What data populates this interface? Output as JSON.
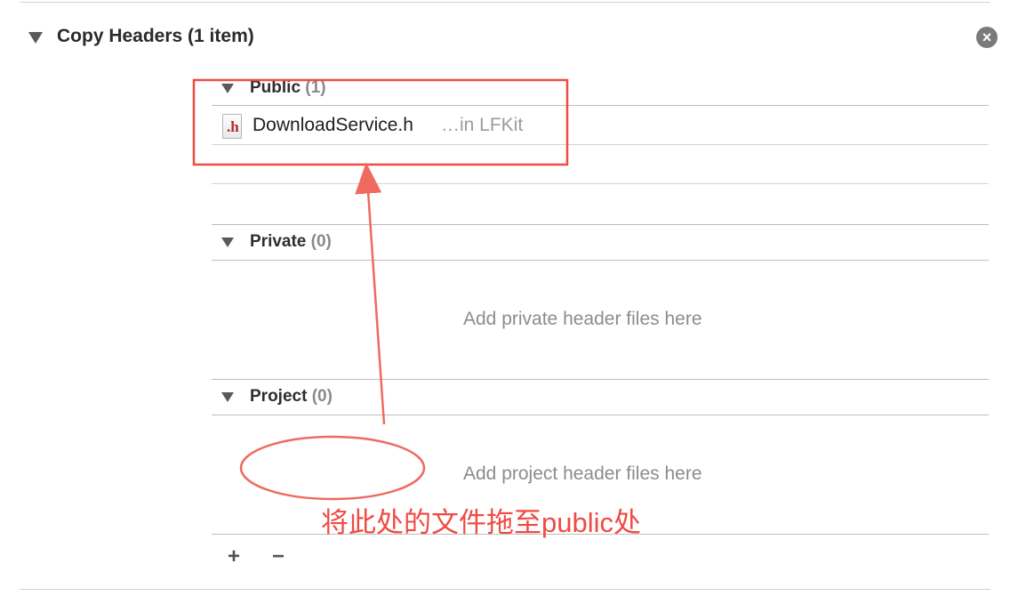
{
  "phase": {
    "title": "Copy Headers (1 item)",
    "close_symbol": "×"
  },
  "groups": {
    "public": {
      "label": "Public",
      "count": "(1)"
    },
    "private": {
      "label": "Private",
      "count": "(0)",
      "placeholder": "Add private header files here"
    },
    "project": {
      "label": "Project",
      "count": "(0)",
      "placeholder": "Add project header files here"
    }
  },
  "file": {
    "icon_letter": ".h",
    "name": "DownloadService.h",
    "location": "…in LFKit"
  },
  "toolbar": {
    "add_symbol": "+",
    "remove_symbol": "−"
  },
  "annotation": {
    "text": "将此处的文件拖至public处",
    "color": "#ef4b45"
  },
  "icons": [
    "disclosure-triangle-icon",
    "close-circle-icon",
    "header-file-icon",
    "plus-icon",
    "minus-icon"
  ]
}
